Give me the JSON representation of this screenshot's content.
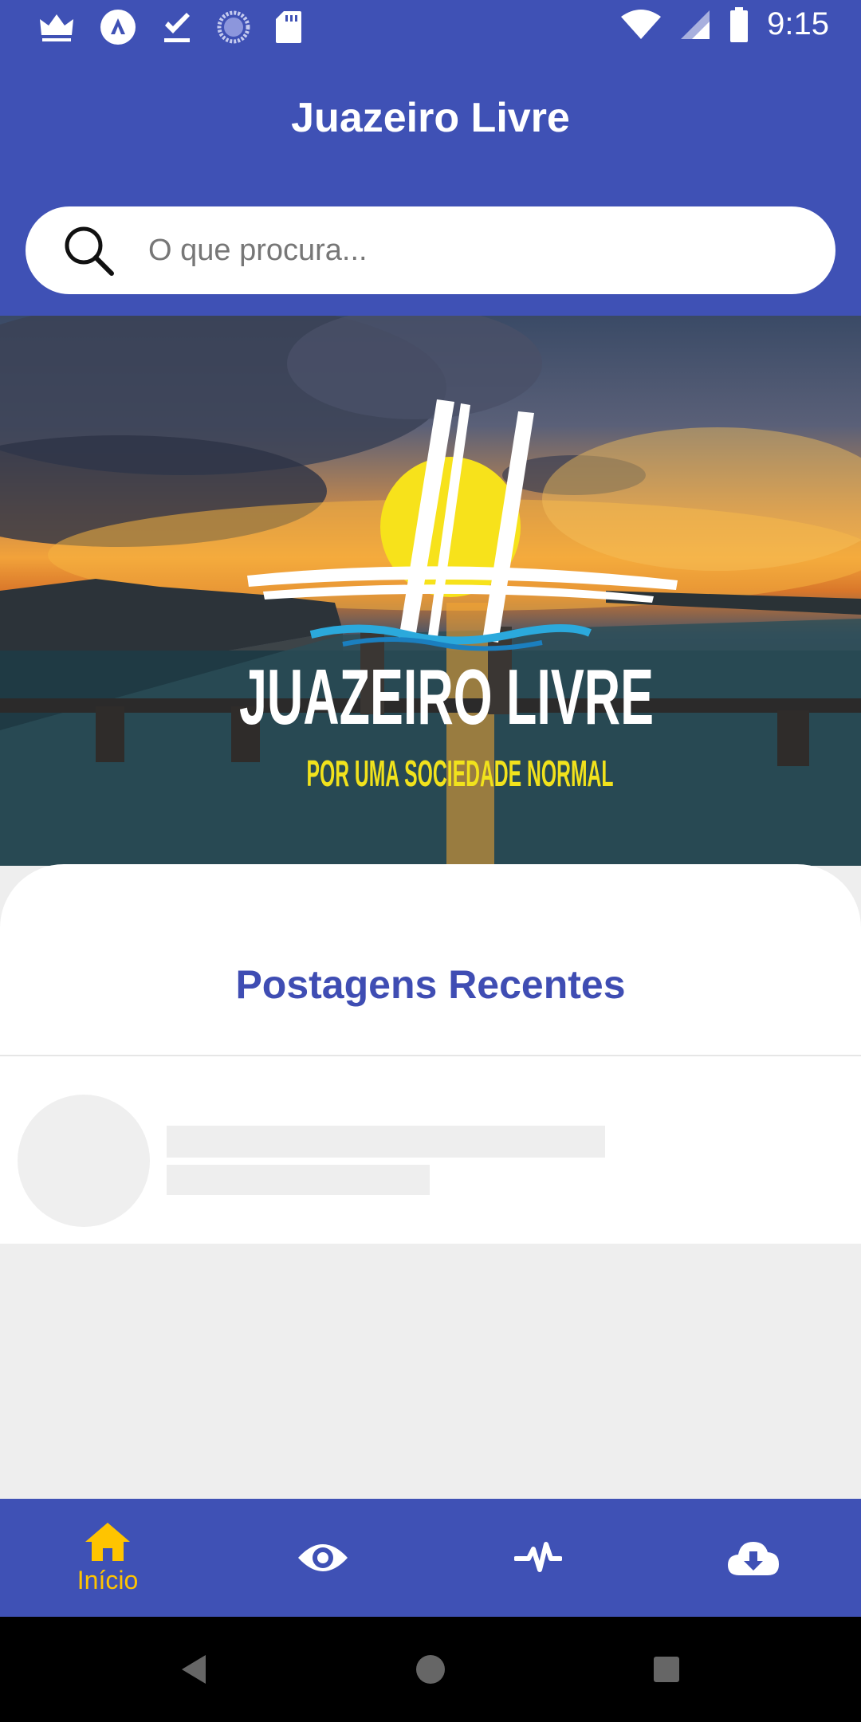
{
  "status_bar": {
    "time": "9:15",
    "left_icons": [
      "crown-icon",
      "app-a-icon",
      "download-done-icon",
      "sync-circle-icon",
      "sd-card-icon"
    ],
    "right_icons": [
      "wifi-icon",
      "signal-icon",
      "battery-icon"
    ]
  },
  "app_bar": {
    "title": "Juazeiro Livre",
    "color": "#3f51b5"
  },
  "search": {
    "placeholder": "O que procura...",
    "value": ""
  },
  "hero": {
    "logo_title": "JUAZEIRO LIVRE",
    "logo_tagline": "POR UMA SOCIEDADE NORMAL"
  },
  "recent_posts": {
    "title": "Postagens Recentes",
    "title_color": "#3f4db3"
  },
  "bottom_nav": {
    "items": [
      {
        "icon": "home-icon",
        "label": "Início",
        "active": true
      },
      {
        "icon": "eye-icon",
        "label": "",
        "active": false
      },
      {
        "icon": "pulse-icon",
        "label": "",
        "active": false
      },
      {
        "icon": "cloud-download-icon",
        "label": "",
        "active": false
      }
    ],
    "active_color": "#ffc400"
  }
}
